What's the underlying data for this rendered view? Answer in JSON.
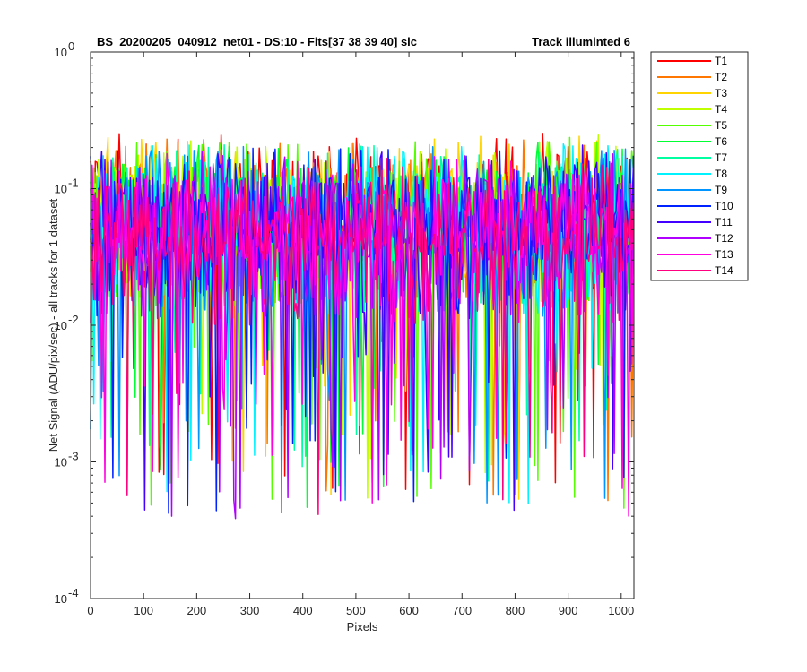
{
  "chart_data": {
    "type": "line",
    "title": "BS_20200205_040912_net01 - DS:10 - Fits[37  38  39  40]   slc",
    "title_right": "Track illuminted 6",
    "xlabel": "Pixels",
    "ylabel": "Net Signal (ADU/pix/sec) - all tracks for 1 dataset",
    "xlim": [
      0,
      1024
    ],
    "ylim": [
      0.0001,
      1
    ],
    "yscale": "log",
    "x_ticks": [
      0,
      100,
      200,
      300,
      400,
      500,
      600,
      700,
      800,
      900,
      1000
    ],
    "x_tick_labels": [
      "0",
      "100",
      "200",
      "300",
      "400",
      "500",
      "600",
      "700",
      "800",
      "900",
      "1000"
    ],
    "y_ticks": [
      0.0001,
      0.001,
      0.01,
      0.1,
      1
    ],
    "y_tick_labels": [
      {
        "base": "10",
        "exp": "-4"
      },
      {
        "base": "10",
        "exp": "-3"
      },
      {
        "base": "10",
        "exp": "-2"
      },
      {
        "base": "10",
        "exp": "-1"
      },
      {
        "base": "10",
        "exp": "0"
      }
    ],
    "grid": false,
    "legend_position": "outside-right",
    "series": [
      {
        "name": "T1",
        "color": "#ff0000"
      },
      {
        "name": "T2",
        "color": "#ff7700"
      },
      {
        "name": "T3",
        "color": "#ffd400"
      },
      {
        "name": "T4",
        "color": "#c0ff00"
      },
      {
        "name": "T5",
        "color": "#55ff00"
      },
      {
        "name": "T6",
        "color": "#00ff33"
      },
      {
        "name": "T7",
        "color": "#00ffa0"
      },
      {
        "name": "T8",
        "color": "#00f2ff"
      },
      {
        "name": "T9",
        "color": "#0095ff"
      },
      {
        "name": "T10",
        "color": "#0022ff"
      },
      {
        "name": "T11",
        "color": "#4400ff"
      },
      {
        "name": "T12",
        "color": "#b000ff"
      },
      {
        "name": "T13",
        "color": "#ff00e0"
      },
      {
        "name": "T14",
        "color": "#ff0080"
      }
    ]
  }
}
